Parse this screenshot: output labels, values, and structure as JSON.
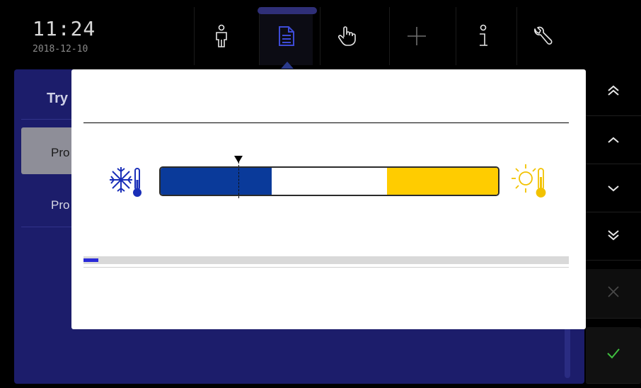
{
  "header": {
    "time": "11:24",
    "date": "2018-12-10"
  },
  "nav_tabs": [
    {
      "icon": "person-icon",
      "active": false
    },
    {
      "icon": "document-icon",
      "active": true
    },
    {
      "icon": "hand-pointer-icon",
      "active": false
    },
    {
      "icon": "plus-icon",
      "active": false
    },
    {
      "icon": "info-icon",
      "active": false
    },
    {
      "icon": "wrench-icon",
      "active": false
    }
  ],
  "main": {
    "title": "Try",
    "programs": [
      {
        "label": "Pro",
        "selected": true
      },
      {
        "label": "Pro",
        "selected": false
      }
    ]
  },
  "sidebar": {
    "buttons": [
      {
        "icon": "double-chevron-up-icon",
        "enabled": true
      },
      {
        "icon": "chevron-up-icon",
        "enabled": true
      },
      {
        "icon": "chevron-down-icon",
        "enabled": true
      },
      {
        "icon": "double-chevron-down-icon",
        "enabled": true
      },
      {
        "icon": "close-icon",
        "enabled": false
      },
      {
        "icon": "checkmark-icon",
        "enabled": true
      }
    ]
  },
  "dialog": {
    "title": "",
    "temperature_scale": {
      "cold_color": "#0a3a9a",
      "neutral_color": "#ffffff",
      "hot_color": "#ffcc00",
      "cold_fraction": 0.33,
      "hot_fraction": 0.33,
      "marker_fraction": 0.23
    },
    "progress_fraction": 0.03
  },
  "colors": {
    "accent_blue": "#1c1d6b",
    "confirm_green": "#3fbf3f",
    "progress_blue": "#2a2ad8"
  }
}
